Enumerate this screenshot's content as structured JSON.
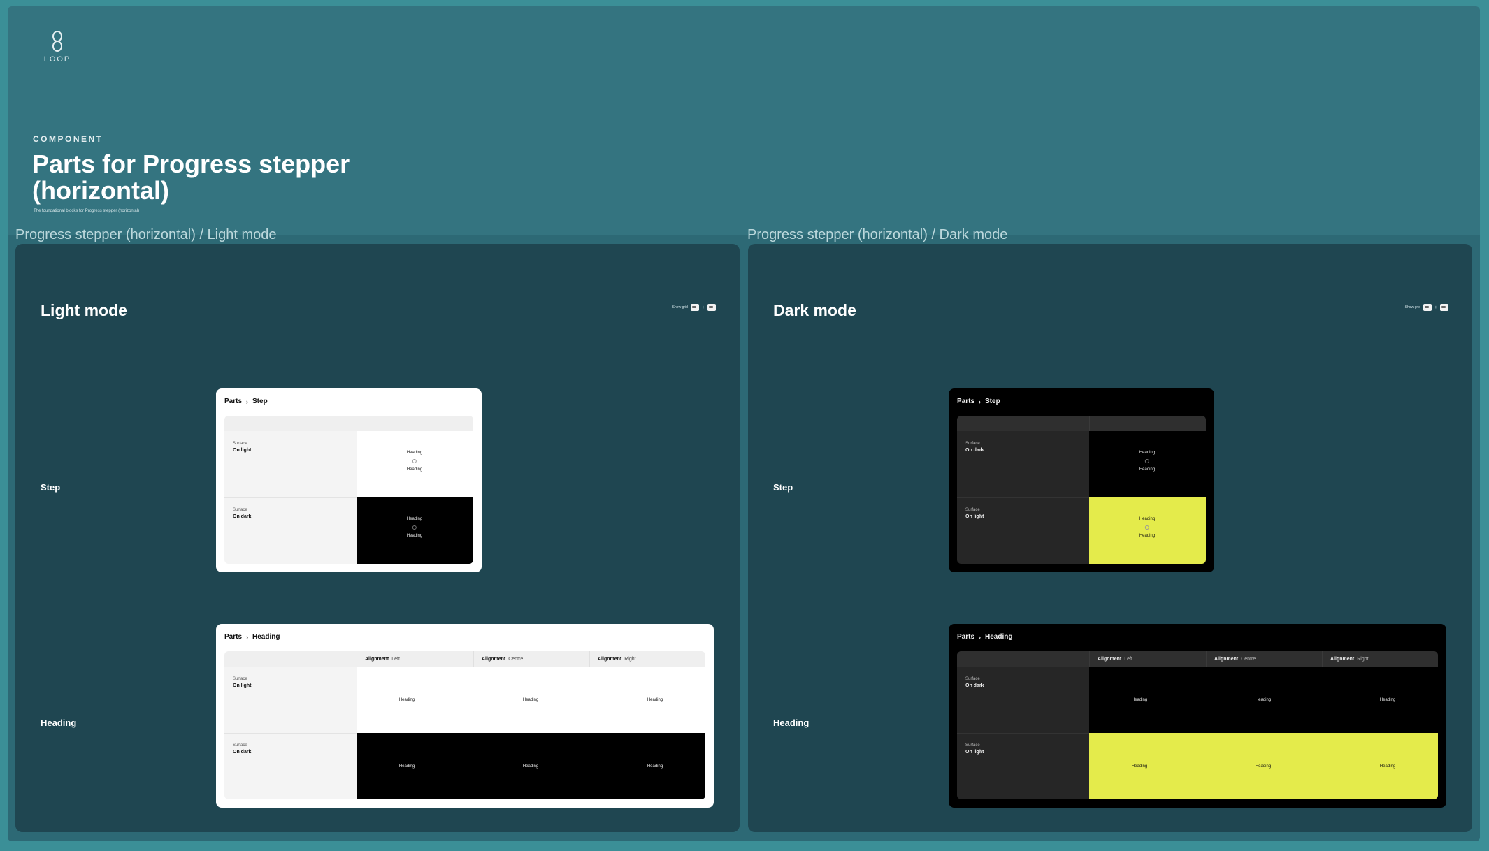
{
  "brand": {
    "logo_text": "LOOP"
  },
  "hero": {
    "eyebrow": "COMPONENT",
    "title": "Parts for Progress stepper (horizontal)",
    "description": "The foundational blocks for Progress stepper (horizontal)"
  },
  "sections": {
    "light": "Progress stepper (horizontal) / Light mode",
    "dark": "Progress stepper (horizontal) / Dark mode"
  },
  "light_panel": {
    "title": "Light mode",
    "show_grid": "Show grid",
    "rows": {
      "step": "Step",
      "heading": "Heading"
    },
    "step_card": {
      "crumb_root": "Parts",
      "crumb_leaf": "Step",
      "row1_caption": "Surface",
      "row1_value": "On light",
      "row2_caption": "Surface",
      "row2_value": "On dark",
      "sample_text": "Heading"
    },
    "heading_card": {
      "crumb_root": "Parts",
      "crumb_leaf": "Heading",
      "col_key": "Alignment",
      "col1": "Left",
      "col2": "Centre",
      "col3": "Right",
      "row1_caption": "Surface",
      "row1_value": "On light",
      "row2_caption": "Surface",
      "row2_value": "On dark",
      "sample_text": "Heading"
    }
  },
  "dark_panel": {
    "title": "Dark mode",
    "show_grid": "Show grid",
    "rows": {
      "step": "Step",
      "heading": "Heading"
    },
    "step_card": {
      "crumb_root": "Parts",
      "crumb_leaf": "Step",
      "row1_caption": "Surface",
      "row1_value": "On dark",
      "row2_caption": "Surface",
      "row2_value": "On light",
      "sample_text": "Heading"
    },
    "heading_card": {
      "crumb_root": "Parts",
      "crumb_leaf": "Heading",
      "col_key": "Alignment",
      "col1": "Left",
      "col2": "Centre",
      "col3": "Right",
      "row1_caption": "Surface",
      "row1_value": "On dark",
      "row2_caption": "Surface",
      "row2_value": "On light",
      "sample_text": "Heading"
    }
  },
  "colors": {
    "page": "#347480",
    "panel": "#1f4651",
    "accent_yellow": "#e4eb4b"
  }
}
